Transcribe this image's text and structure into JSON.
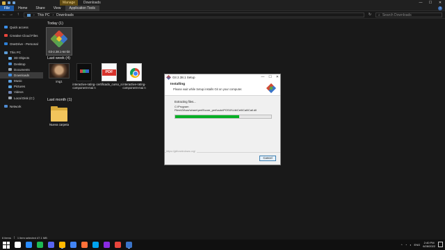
{
  "window": {
    "context_tab": "Manage",
    "title": "Downloads",
    "controls": [
      "—",
      "☐",
      "✕"
    ]
  },
  "ribbon": {
    "tabs": [
      "File",
      "Home",
      "Share",
      "View",
      "Application Tools"
    ],
    "help": "?"
  },
  "address": {
    "crumbs": [
      "This PC",
      "Downloads"
    ],
    "search_placeholder": "Search Downloads"
  },
  "sidebar": {
    "items": [
      {
        "label": "Quick access",
        "color": "#3b8ee8"
      },
      {
        "label": "Creative Cloud Files",
        "color": "#e8453c"
      },
      {
        "label": "OneDrive - Personal",
        "color": "#2d7fd6"
      },
      {
        "label": "This PC",
        "color": "#5b9bd5"
      },
      {
        "label": "3D Objects",
        "color": "#6fb0e8"
      },
      {
        "label": "Desktop",
        "color": "#4a8fd8"
      },
      {
        "label": "Documents",
        "color": "#9aa6b2"
      },
      {
        "label": "Downloads",
        "color": "#3f8fe3"
      },
      {
        "label": "Music",
        "color": "#5a9de0"
      },
      {
        "label": "Pictures",
        "color": "#5aa6e6"
      },
      {
        "label": "Videos",
        "color": "#6f86b9"
      },
      {
        "label": "Local Disk (C:)",
        "color": "#9fa9b4"
      },
      {
        "label": "Network",
        "color": "#4f8bd1"
      }
    ]
  },
  "groups": {
    "today": "Today (1)",
    "last_week": "Last week (4)",
    "last_month": "Last month (1)"
  },
  "files": {
    "git": "Git-2.38.1-64-bit",
    "img1": "img1",
    "interactive1": "interactive-rating-component-mai n",
    "certificado": "certificado_curso_s",
    "interactive2": "interactive-rating-component-mai n",
    "nueva": "Nueva carpeta",
    "pdf_label": "PDF"
  },
  "dialog": {
    "title": "Git 2.38.1 Setup",
    "controls": [
      "—",
      "☐",
      "✕"
    ],
    "header_title": "Installing",
    "header_sub": "Please wait while Setup installs Git on your computer.",
    "extracting": "Extracting files...",
    "path": "C:\\Program Files\\Git\\usr\\share\\perl5\\core_perl\\auto\\POSIX\\Lib\\Cell\\Call\\Call.dll",
    "progress": 0.67,
    "footer_url": "https://gitforwindows.org/",
    "cancel": "Cancel"
  },
  "status": {
    "items": "6 items",
    "selected": "1 item selected  47.1 MB"
  },
  "taskbar": {
    "icon_colors": [
      "#ffffff",
      "#2a8cff",
      "#1db954",
      "#5865f2",
      "#0078d4",
      "#ffb900",
      "#4285f4",
      "#ff7139",
      "#00a4ef",
      "#8a2be2",
      "#e8453c",
      "#3a74c9"
    ],
    "lang": "ENG",
    "time": "2:40 PM",
    "date": "6/28/2022"
  },
  "colors": {
    "accent": "#1f5aa5",
    "progress": "#06b025",
    "manage_tab": "#5f4a12"
  }
}
